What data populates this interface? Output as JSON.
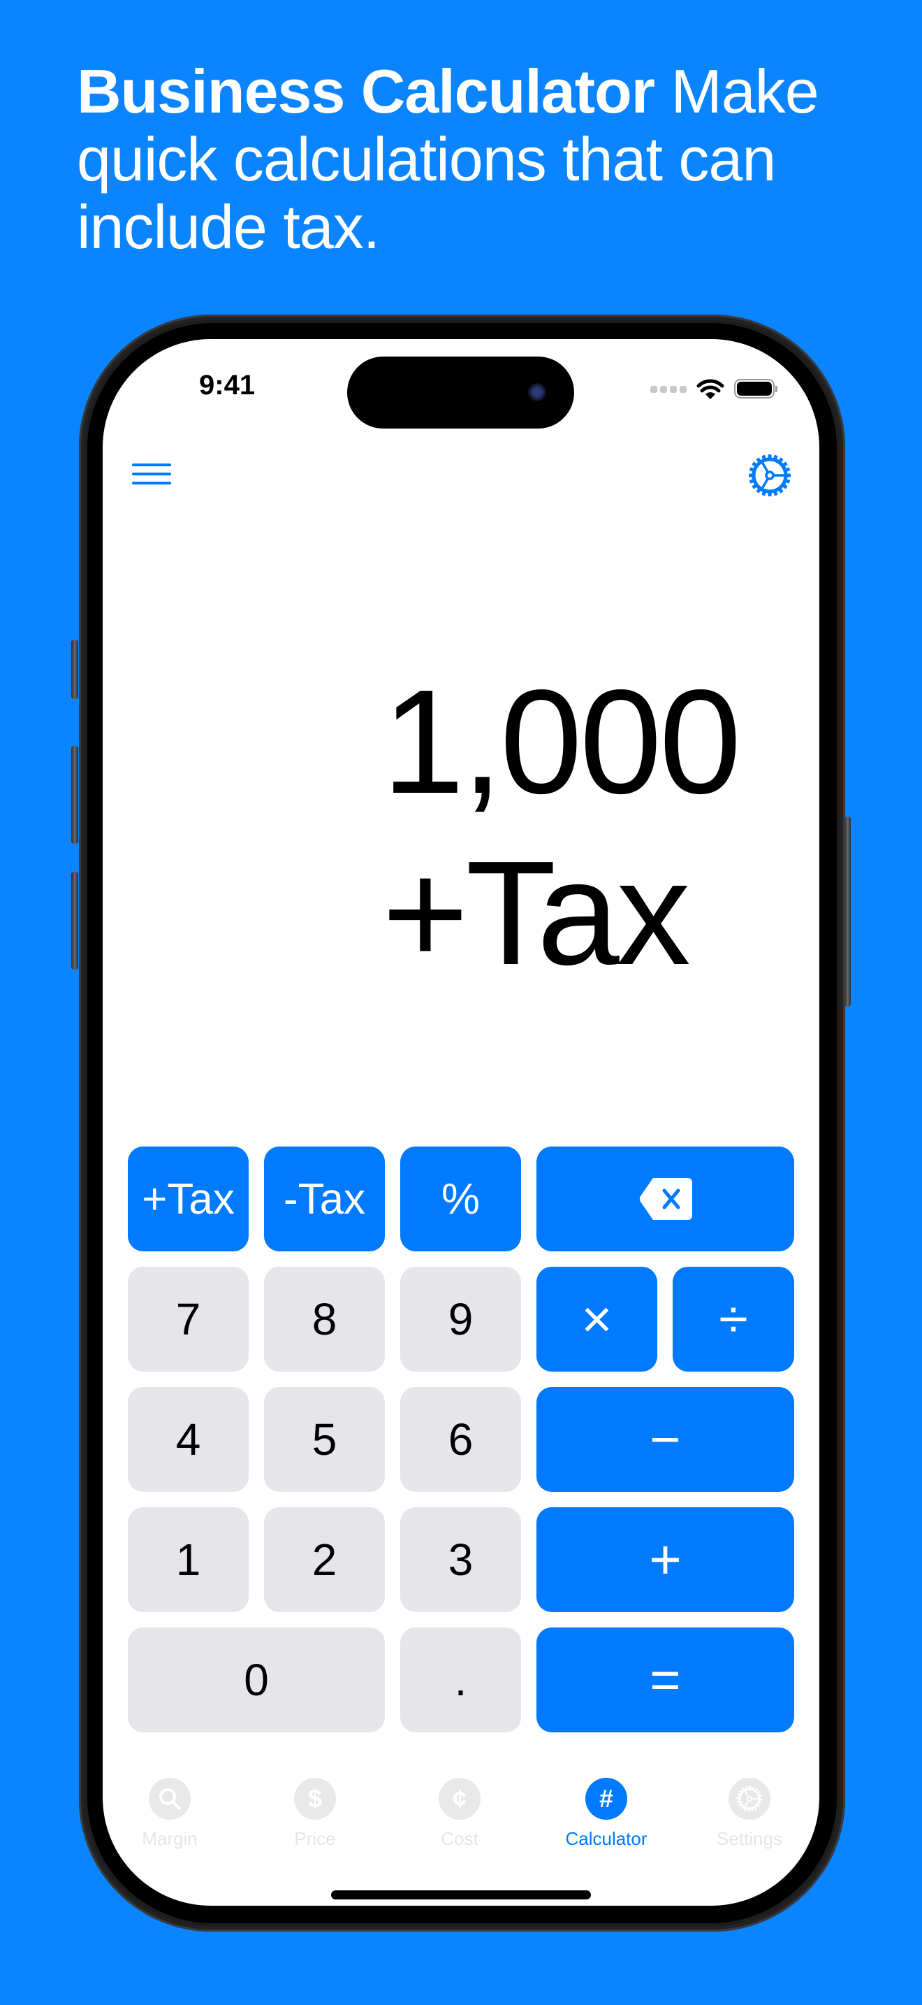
{
  "headline": {
    "bold": "Business Calculator",
    "text": " Make quick calculations that can include tax."
  },
  "status_bar": {
    "time": "9:41",
    "icons": [
      "signal-icon",
      "wifi-icon",
      "battery-icon"
    ]
  },
  "nav": {
    "left_icon": "menu-icon",
    "right_icon": "gear-icon"
  },
  "display": {
    "value": "1,000",
    "operation": "+Tax"
  },
  "keypad": {
    "row1": [
      {
        "label": "+Tax",
        "style": "blue"
      },
      {
        "label": "-Tax",
        "style": "blue"
      },
      {
        "label": "%",
        "style": "blue"
      },
      {
        "label": "",
        "icon": "delete-backspace-icon",
        "style": "blue"
      }
    ],
    "row2": [
      {
        "label": "7",
        "style": "gray"
      },
      {
        "label": "8",
        "style": "gray"
      },
      {
        "label": "9",
        "style": "gray"
      },
      {
        "label": "×",
        "style": "blue"
      },
      {
        "label": "÷",
        "style": "blue"
      }
    ],
    "row3": [
      {
        "label": "4",
        "style": "gray"
      },
      {
        "label": "5",
        "style": "gray"
      },
      {
        "label": "6",
        "style": "gray"
      },
      {
        "label": "−",
        "style": "blue"
      }
    ],
    "row4": [
      {
        "label": "1",
        "style": "gray"
      },
      {
        "label": "2",
        "style": "gray"
      },
      {
        "label": "3",
        "style": "gray"
      },
      {
        "label": "+",
        "style": "blue"
      }
    ],
    "row5": [
      {
        "label": "0",
        "style": "gray"
      },
      {
        "label": ".",
        "style": "gray"
      },
      {
        "label": "=",
        "style": "blue"
      }
    ]
  },
  "tabbar": {
    "items": [
      {
        "label": "Margin",
        "glyph": "⚲",
        "icon": "magnifier-icon",
        "active": false
      },
      {
        "label": "Price",
        "glyph": "$",
        "icon": "dollar-icon",
        "active": false
      },
      {
        "label": "Cost",
        "glyph": "¢",
        "icon": "cent-icon",
        "active": false
      },
      {
        "label": "Calculator",
        "glyph": "#",
        "icon": "hash-icon",
        "active": true
      },
      {
        "label": "Settings",
        "glyph": "⚙",
        "icon": "gear-icon",
        "active": false
      }
    ]
  },
  "colors": {
    "background": "#0A84FF",
    "accent": "#007AFF",
    "key_gray": "#E5E5EA",
    "tab_inactive": "#E5E5E5"
  }
}
